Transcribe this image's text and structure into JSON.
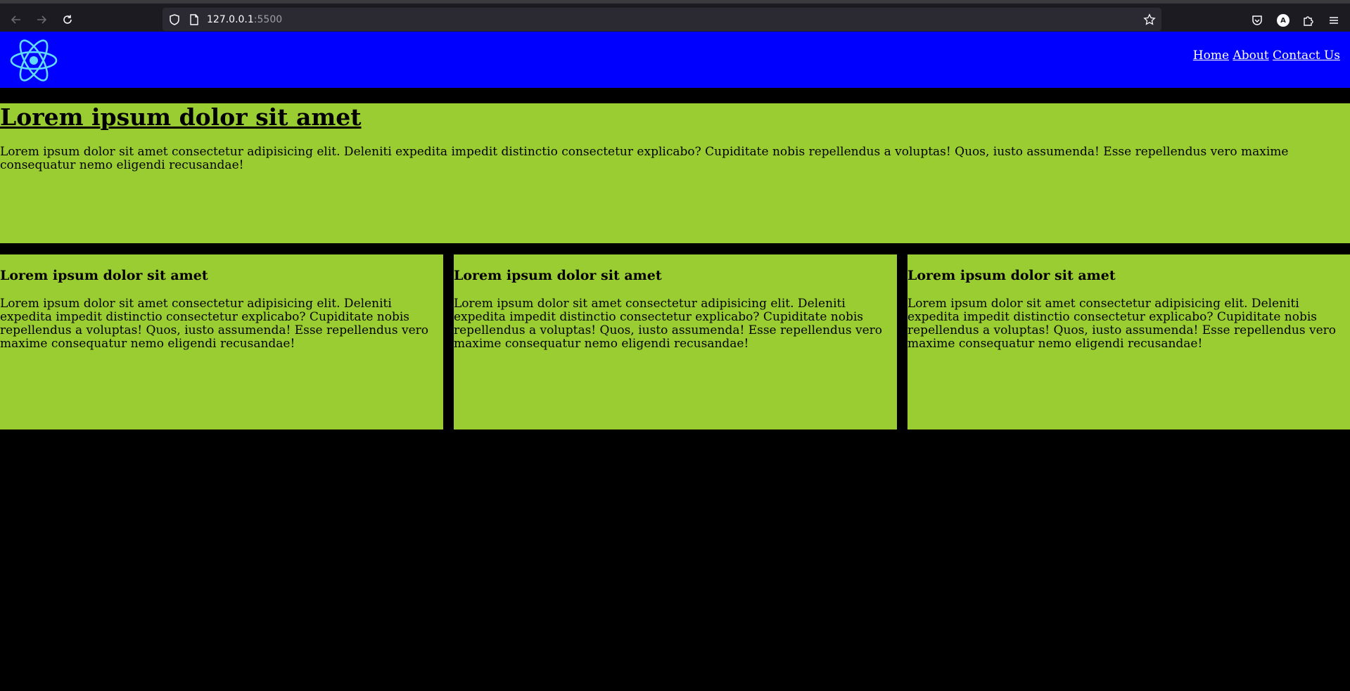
{
  "browser": {
    "url_host": "127.0.0.1",
    "url_port": ":5500",
    "avatar_letter": "A"
  },
  "header": {
    "logo_icon": "react-atom-logo",
    "nav": {
      "home": "Home",
      "about": "About",
      "contact": "Contact Us"
    },
    "background": "#0000ff"
  },
  "hero": {
    "title": "Lorem ipsum dolor sit amet",
    "text": "Lorem ipsum dolor sit amet consectetur adipisicing elit. Deleniti expedita impedit distinctio consectetur explicabo? Cupiditate nobis repellendus a voluptas! Quos, iusto assumenda! Esse repellendus vero maxime consequatur nemo eligendi recusandae!",
    "background": "#9acd32"
  },
  "cards": [
    {
      "title": "Lorem ipsum dolor sit amet",
      "text": "Lorem ipsum dolor sit amet consectetur adipisicing elit. Deleniti expedita impedit distinctio consectetur explicabo? Cupiditate nobis repellendus a voluptas! Quos, iusto assumenda! Esse repellendus vero maxime consequatur nemo eligendi recusandae!"
    },
    {
      "title": "Lorem ipsum dolor sit amet",
      "text": "Lorem ipsum dolor sit amet consectetur adipisicing elit. Deleniti expedita impedit distinctio consectetur explicabo? Cupiditate nobis repellendus a voluptas! Quos, iusto assumenda! Esse repellendus vero maxime consequatur nemo eligendi recusandae!"
    },
    {
      "title": "Lorem ipsum dolor sit amet",
      "text": "Lorem ipsum dolor sit amet consectetur adipisicing elit. Deleniti expedita impedit distinctio consectetur explicabo? Cupiditate nobis repellendus a voluptas! Quos, iusto assumenda! Esse repellendus vero maxime consequatur nemo eligendi recusandae!"
    }
  ]
}
